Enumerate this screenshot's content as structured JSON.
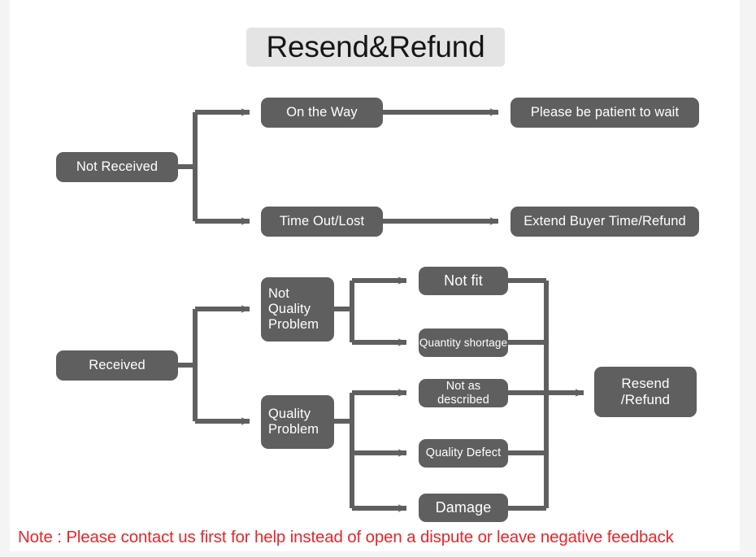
{
  "page": {
    "title": "Resend&Refund",
    "note": "Note : Please contact us first for help instead of open a dispute or leave negative feedback",
    "background_color": "#f4f4f4",
    "card_color": "#ffffff",
    "node_color": "#5f5f5f",
    "node_text_color": "#ffffff",
    "connector_color": "#5f5f5f",
    "title_highlight_color": "#e4e4e4",
    "title_text_color": "#161616",
    "note_color": "#e8262a"
  },
  "chart_data": {
    "type": "diagram",
    "title": "Resend&Refund",
    "diagram_kind": "flowchart",
    "direction": "left-to-right",
    "nodes": [
      {
        "id": "not_received",
        "label": "Not Received",
        "level": 0
      },
      {
        "id": "on_the_way",
        "label": "On the Way",
        "level": 1
      },
      {
        "id": "time_out_lost",
        "label": "Time Out/Lost",
        "level": 1
      },
      {
        "id": "be_patient",
        "label": "Please be patient to wait",
        "level": 2
      },
      {
        "id": "extend_refund",
        "label": "Extend Buyer Time/Refund",
        "level": 2
      },
      {
        "id": "received",
        "label": "Received",
        "level": 0
      },
      {
        "id": "not_quality",
        "label": "Not\nQuality\nProblem",
        "level": 1
      },
      {
        "id": "quality",
        "label": "Quality\nProblem",
        "level": 1
      },
      {
        "id": "not_fit",
        "label": "Not fit",
        "level": 2
      },
      {
        "id": "qty_shortage",
        "label": "Quantity shortage",
        "level": 2
      },
      {
        "id": "not_described",
        "label": "Not as described",
        "level": 2
      },
      {
        "id": "quality_defect",
        "label": "Quality Defect",
        "level": 2
      },
      {
        "id": "damage",
        "label": "Damage",
        "level": 2
      },
      {
        "id": "resend_refund",
        "label": "Resend\n/Refund",
        "level": 3
      }
    ],
    "edges": [
      {
        "from": "not_received",
        "to": "on_the_way"
      },
      {
        "from": "not_received",
        "to": "time_out_lost"
      },
      {
        "from": "on_the_way",
        "to": "be_patient"
      },
      {
        "from": "time_out_lost",
        "to": "extend_refund"
      },
      {
        "from": "received",
        "to": "not_quality"
      },
      {
        "from": "received",
        "to": "quality"
      },
      {
        "from": "not_quality",
        "to": "not_fit"
      },
      {
        "from": "not_quality",
        "to": "qty_shortage"
      },
      {
        "from": "quality",
        "to": "not_described"
      },
      {
        "from": "quality",
        "to": "quality_defect"
      },
      {
        "from": "quality",
        "to": "damage"
      },
      {
        "from": "not_fit",
        "to": "resend_refund"
      },
      {
        "from": "qty_shortage",
        "to": "resend_refund"
      },
      {
        "from": "not_described",
        "to": "resend_refund"
      },
      {
        "from": "quality_defect",
        "to": "resend_refund"
      },
      {
        "from": "damage",
        "to": "resend_refund"
      }
    ]
  },
  "nodes": {
    "not_received": {
      "label": "Not Received"
    },
    "on_the_way": {
      "label": "On the Way"
    },
    "time_out_lost": {
      "label": "Time Out/Lost"
    },
    "be_patient": {
      "label": "Please be patient to wait"
    },
    "extend_refund": {
      "label": "Extend Buyer Time/Refund"
    },
    "received": {
      "label": "Received"
    },
    "not_quality": {
      "label": "Not\nQuality\nProblem"
    },
    "quality": {
      "label": "Quality\nProblem"
    },
    "not_fit": {
      "label": "Not fit"
    },
    "qty_shortage": {
      "label": "Quantity shortage"
    },
    "not_described": {
      "label": "Not as described"
    },
    "quality_defect": {
      "label": "Quality Defect"
    },
    "damage": {
      "label": "Damage"
    },
    "resend_refund": {
      "label": "Resend\n/Refund"
    }
  }
}
